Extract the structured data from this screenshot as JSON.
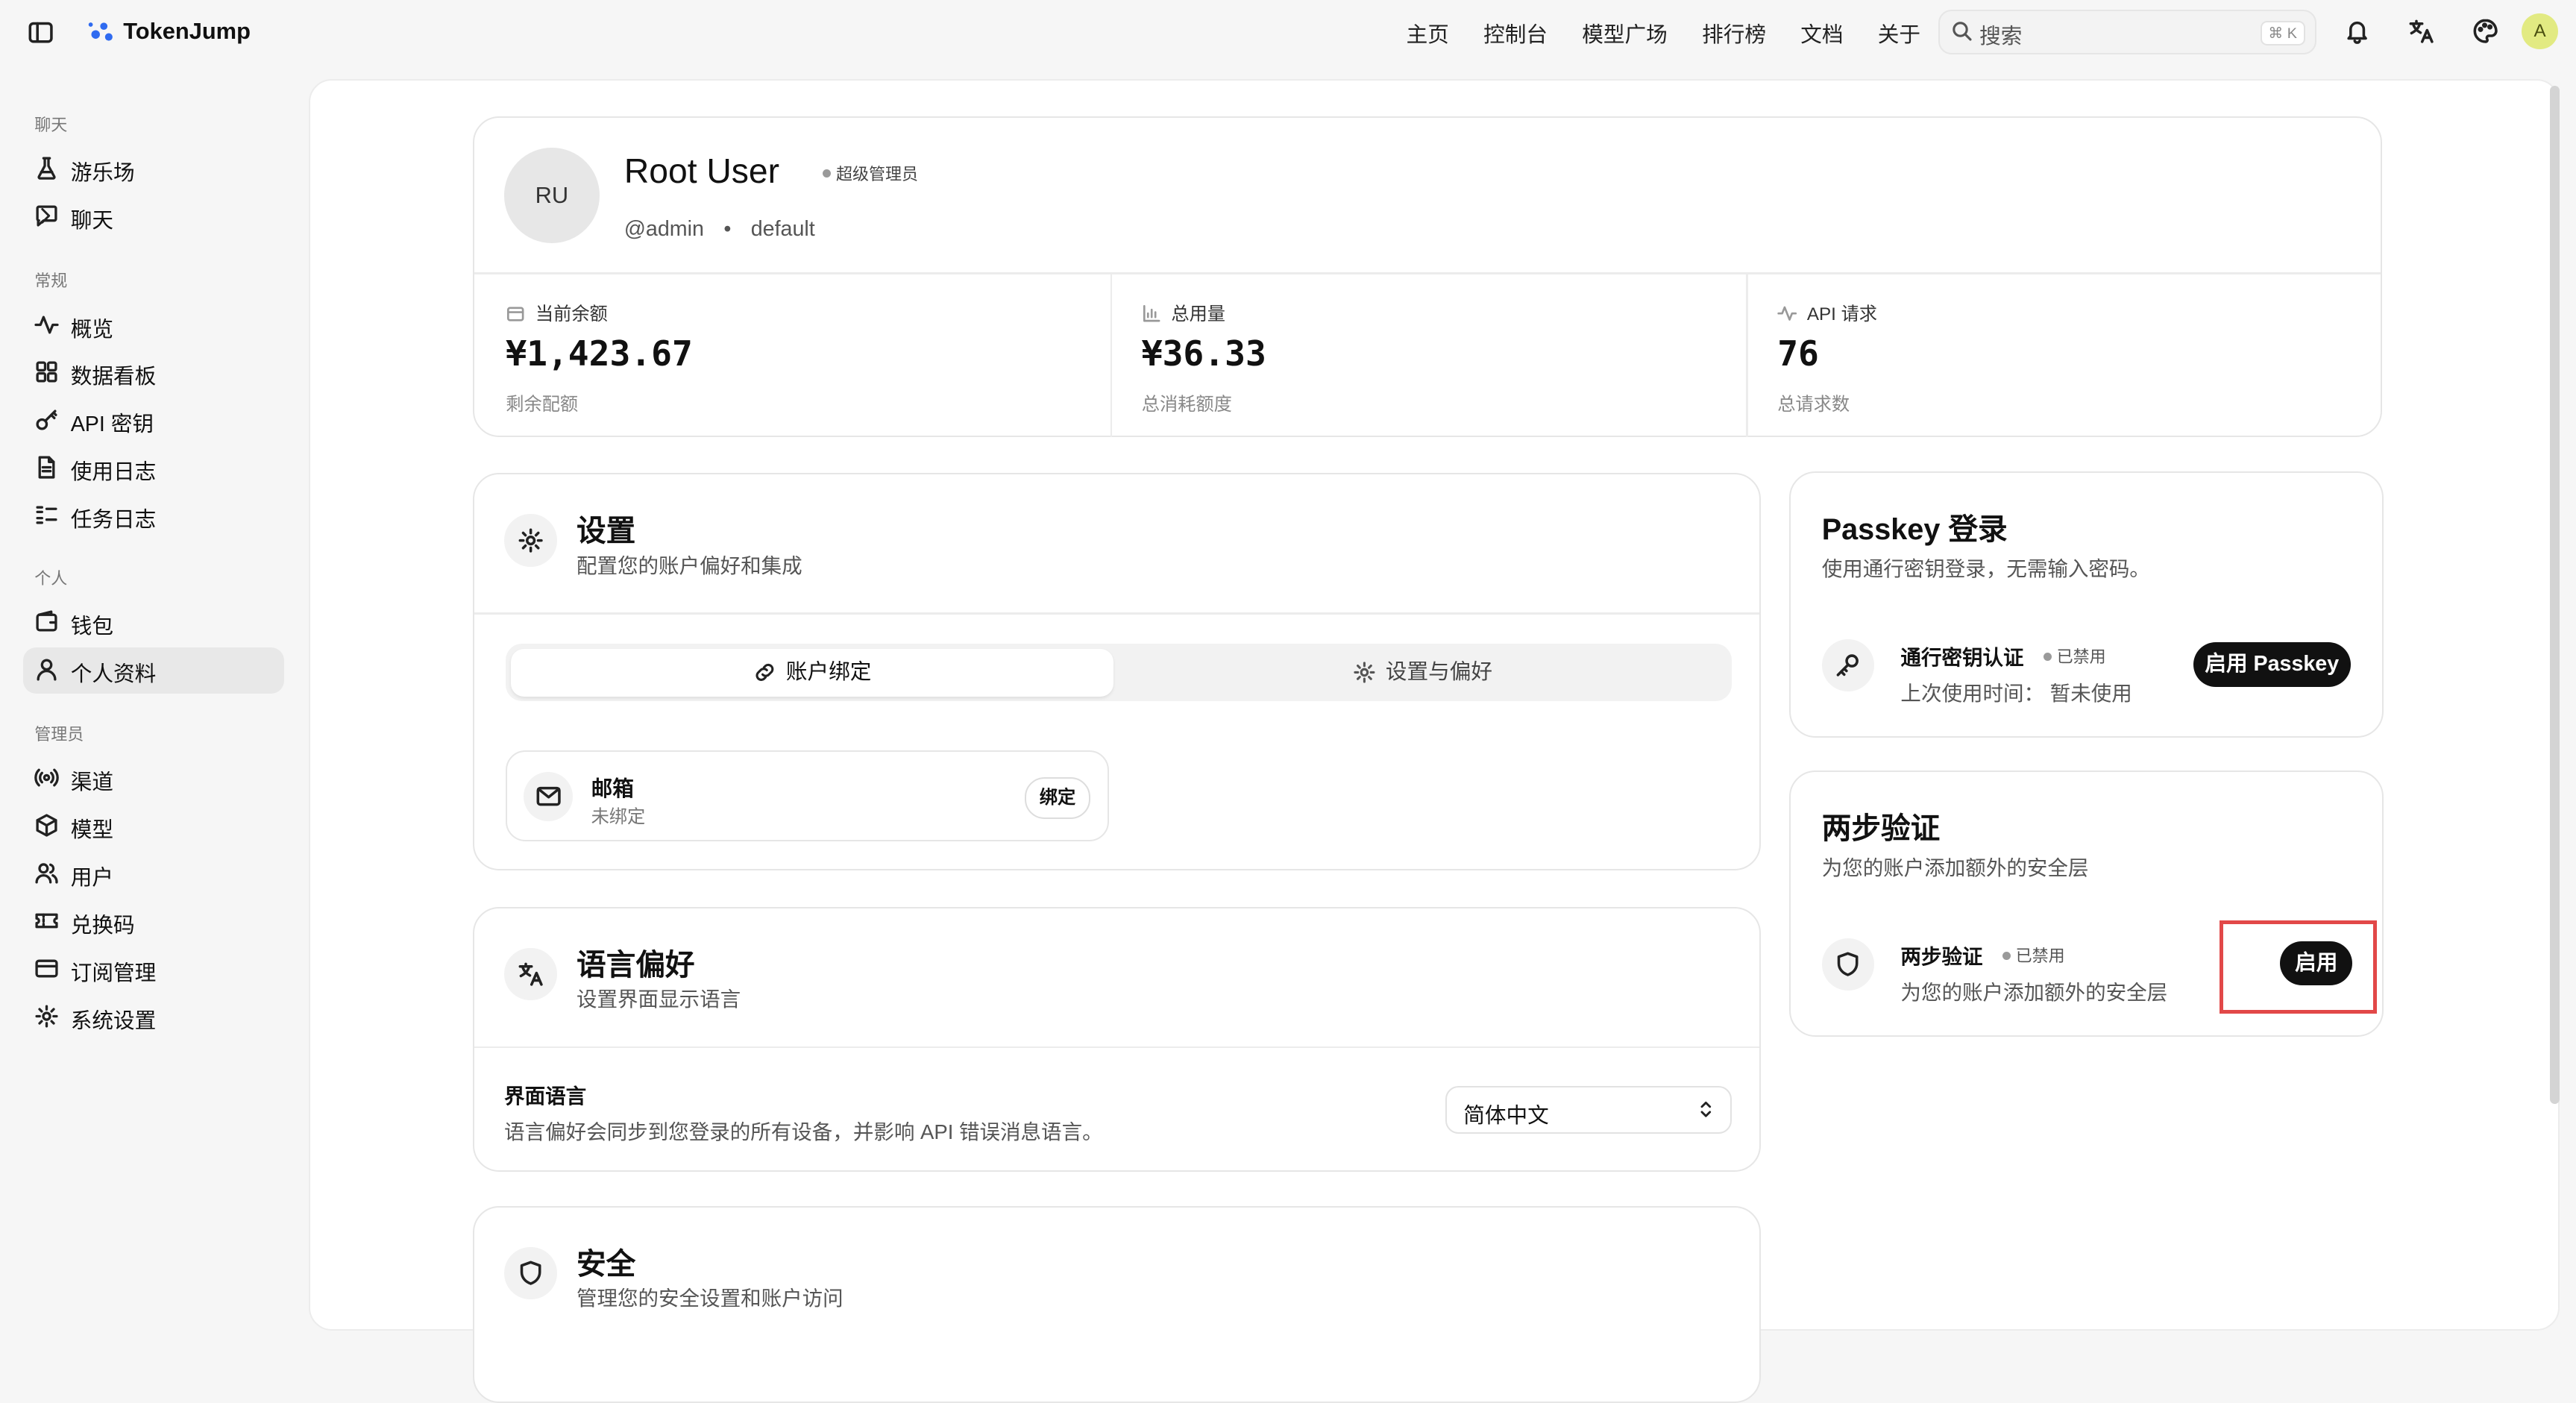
{
  "brand": {
    "name": "TokenJump"
  },
  "topnav": {
    "links": [
      "主页",
      "控制台",
      "模型广场",
      "排行榜",
      "文档",
      "关于"
    ],
    "search": {
      "placeholder": "搜索",
      "shortcut": "⌘ K"
    },
    "user_initial": "A"
  },
  "sidebar": {
    "groups": [
      {
        "title": "聊天",
        "items": [
          {
            "label": "游乐场",
            "icon": "flask-icon"
          },
          {
            "label": "聊天",
            "icon": "chat-icon",
            "has_submenu": true
          }
        ]
      },
      {
        "title": "常规",
        "items": [
          {
            "label": "概览",
            "icon": "activity-icon"
          },
          {
            "label": "数据看板",
            "icon": "dashboard-icon"
          },
          {
            "label": "API 密钥",
            "icon": "key-icon"
          },
          {
            "label": "使用日志",
            "icon": "file-icon"
          },
          {
            "label": "任务日志",
            "icon": "list-icon"
          }
        ]
      },
      {
        "title": "个人",
        "items": [
          {
            "label": "钱包",
            "icon": "wallet-icon"
          },
          {
            "label": "个人资料",
            "icon": "user-icon",
            "active": true
          }
        ]
      },
      {
        "title": "管理员",
        "items": [
          {
            "label": "渠道",
            "icon": "radio-icon"
          },
          {
            "label": "模型",
            "icon": "cube-icon"
          },
          {
            "label": "用户",
            "icon": "users-icon"
          },
          {
            "label": "兑换码",
            "icon": "ticket-icon"
          },
          {
            "label": "订阅管理",
            "icon": "card-icon"
          },
          {
            "label": "系统设置",
            "icon": "gear-icon"
          }
        ]
      }
    ]
  },
  "profile": {
    "initials": "RU",
    "name": "Root User",
    "role": "超级管理员",
    "username": "@admin",
    "sep": "•",
    "group": "default",
    "stats": [
      {
        "label": "当前余额",
        "value": "¥1,423.67",
        "sub": "剩余配额",
        "icon": "wallet-icon"
      },
      {
        "label": "总用量",
        "value": "¥36.33",
        "sub": "总消耗额度",
        "icon": "bar-chart-icon"
      },
      {
        "label": "API 请求",
        "value": "76",
        "sub": "总请求数",
        "icon": "activity-icon"
      }
    ]
  },
  "settings": {
    "title": "设置",
    "desc": "配置您的账户偏好和集成",
    "tabs": [
      "账户绑定",
      "设置与偏好"
    ],
    "email": {
      "title": "邮箱",
      "status": "未绑定",
      "button": "绑定"
    }
  },
  "language": {
    "title": "语言偏好",
    "desc": "设置界面显示语言",
    "field_label": "界面语言",
    "field_desc": "语言偏好会同步到您登录的所有设备，并影响 API 错误消息语言。",
    "selected": "简体中文"
  },
  "security": {
    "title": "安全",
    "desc": "管理您的安全设置和账户访问"
  },
  "passkey": {
    "title": "Passkey 登录",
    "desc": "使用通行密钥登录，无需输入密码。",
    "item_title": "通行密钥认证",
    "badge": "已禁用",
    "last_used": "上次使用时间：  暂未使用",
    "button": "启用 Passkey"
  },
  "twofa": {
    "title": "两步验证",
    "desc": "为您的账户添加额外的安全层",
    "item_title": "两步验证",
    "badge": "已禁用",
    "item_desc": "为您的账户添加额外的安全层",
    "button": "启用"
  },
  "colors": {
    "accent_dark": "#111111",
    "highlight": "#e24848",
    "avatar": "#e2ea82"
  }
}
